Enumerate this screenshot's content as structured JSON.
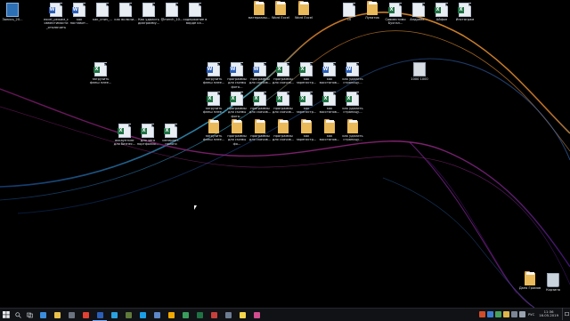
{
  "desktop": {
    "icons": [
      {
        "label": "Запись_20...",
        "type": "blue"
      },
      {
        "label": "excel_режим_совместимости_отключить",
        "type": "word"
      },
      {
        "label": "как поставит...",
        "type": "word"
      },
      {
        "label": "как_сниз_...",
        "type": "doc"
      },
      {
        "label": "как включи...",
        "type": "doc"
      },
      {
        "label": "Как удалить диаграмму...",
        "type": "doc"
      },
      {
        "label": "@merch_10...",
        "type": "doc"
      },
      {
        "label": "содержание в ворде ка...",
        "type": "doc"
      },
      {
        "label": "материалы...",
        "type": "folder"
      },
      {
        "label": "Word Excel",
        "type": "folder"
      },
      {
        "label": "Word Excel",
        "type": "folder"
      },
      {
        "label": "10",
        "type": "doc"
      },
      {
        "label": "Лунатик",
        "type": "folder"
      },
      {
        "label": "Совместимо Бухгал...",
        "type": "excel"
      },
      {
        "label": "Андреев...",
        "type": "doc"
      },
      {
        "label": "Айфон",
        "type": "excel"
      },
      {
        "label": "Инстаграм",
        "type": "excel"
      },
      {
        "label": "загрузить флеш плее...",
        "type": "excel"
      },
      {
        "label": "1000 1000",
        "type": "jpg"
      },
      {
        "label": "загрузить флеш плее...",
        "type": "word"
      },
      {
        "label": "программы для съемы фото...",
        "type": "word"
      },
      {
        "label": "программы для скачив...",
        "type": "word"
      },
      {
        "label": "программы для скачив...",
        "type": "excel"
      },
      {
        "label": "как зарегистр...",
        "type": "excel"
      },
      {
        "label": "как восстанов...",
        "type": "word"
      },
      {
        "label": "как удалить страницу...",
        "type": "word"
      },
      {
        "label": "загрузить флеш плее...",
        "type": "excel"
      },
      {
        "label": "программы для съемы фото...",
        "type": "excel"
      },
      {
        "label": "программы для скачив...",
        "type": "excel"
      },
      {
        "label": "программы для скачив...",
        "type": "excel"
      },
      {
        "label": "как зарегистр...",
        "type": "excel"
      },
      {
        "label": "как восстанов...",
        "type": "excel"
      },
      {
        "label": "как удалить страницу...",
        "type": "excel"
      },
      {
        "label": "загрузить флеш плее...",
        "type": "folder"
      },
      {
        "label": "программы для съемы фо...",
        "type": "folder"
      },
      {
        "label": "программы для скачив...",
        "type": "folder"
      },
      {
        "label": "программы для скачив...",
        "type": "folder"
      },
      {
        "label": "как зарегистр...",
        "type": "folder"
      },
      {
        "label": "как восстанов...",
        "type": "folder"
      },
      {
        "label": "как удалить страницу...",
        "type": "folder"
      },
      {
        "label": "аккаунтинг для бизнес...",
        "type": "excel"
      },
      {
        "label": "для чего портфолио...",
        "type": "excel"
      },
      {
        "label": "интернет-налоги",
        "type": "excel"
      },
      {
        "label": "Даня Громов",
        "type": "folder"
      },
      {
        "label": "Корзина",
        "type": "recycle"
      }
    ]
  },
  "taskbar": {
    "apps": [
      {
        "name": "edge-app",
        "color": "#3b8ede"
      },
      {
        "name": "explorer-app",
        "color": "#e8c14a"
      },
      {
        "name": "calculator-app",
        "color": "#6b7280"
      },
      {
        "name": "chrome-app",
        "color": "#e34133"
      },
      {
        "name": "word-app",
        "color": "#2b5fb8"
      },
      {
        "name": "photoshop-app",
        "color": "#2aa1e0"
      },
      {
        "name": "maps-app",
        "color": "#5f7a3a"
      },
      {
        "name": "skype-app",
        "color": "#1aa0e8"
      },
      {
        "name": "store-app",
        "color": "#5c87c8"
      },
      {
        "name": "player-app",
        "color": "#f2a900"
      },
      {
        "name": "browser-app",
        "color": "#3a9f5c"
      },
      {
        "name": "excel-app",
        "color": "#1f7244"
      },
      {
        "name": "mail-app",
        "color": "#c7403b"
      },
      {
        "name": "calendar-app",
        "color": "#6c7d92"
      },
      {
        "name": "sticky-app",
        "color": "#f7d54a"
      },
      {
        "name": "paint-app",
        "color": "#d24c8f"
      }
    ],
    "tray": {
      "language": "РУС",
      "time": "11:36",
      "date": "16.05.2019"
    }
  }
}
